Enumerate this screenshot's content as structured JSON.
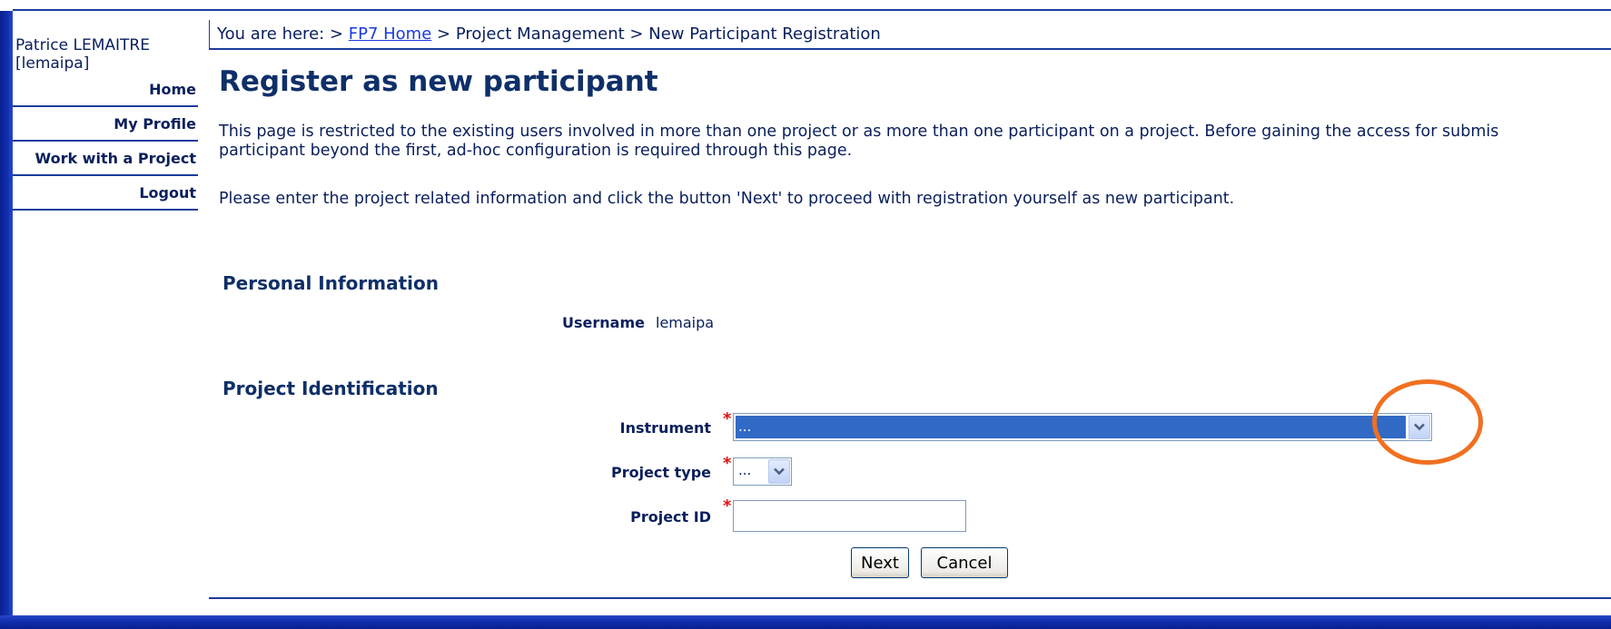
{
  "user": {
    "name": "Patrice LEMAITRE",
    "login": "[lemaipa]"
  },
  "sidebar": {
    "items": [
      {
        "label": "Home"
      },
      {
        "label": "My Profile"
      },
      {
        "label": "Work with a Project"
      },
      {
        "label": "Logout"
      }
    ]
  },
  "breadcrumb": {
    "prefix": "You are here: >",
    "link": "FP7 Home",
    "rest": "> Project Management > New Participant Registration"
  },
  "page": {
    "title": "Register as new participant",
    "para1_line1": "This page is restricted to the existing users involved in more than one project or as more than one participant on a project. Before gaining the access for submis",
    "para1_line2": "participant beyond the first, ad-hoc configuration is required through this page.",
    "para2": "Please enter the project related information and click the button 'Next' to proceed with registration yourself as new participant."
  },
  "personal": {
    "section_title": "Personal Information",
    "username_label": "Username",
    "username_value": "lemaipa"
  },
  "project": {
    "section_title": "Project Identification",
    "instrument_label": "Instrument",
    "instrument_value": "...",
    "project_type_label": "Project type",
    "project_type_value": "...",
    "project_id_label": "Project ID",
    "project_id_value": "",
    "required_mark": "*"
  },
  "buttons": {
    "next": "Next",
    "cancel": "Cancel"
  },
  "colors": {
    "frame": "#1b3c9c",
    "highlight": "#f07020",
    "selected": "#316ac5"
  }
}
